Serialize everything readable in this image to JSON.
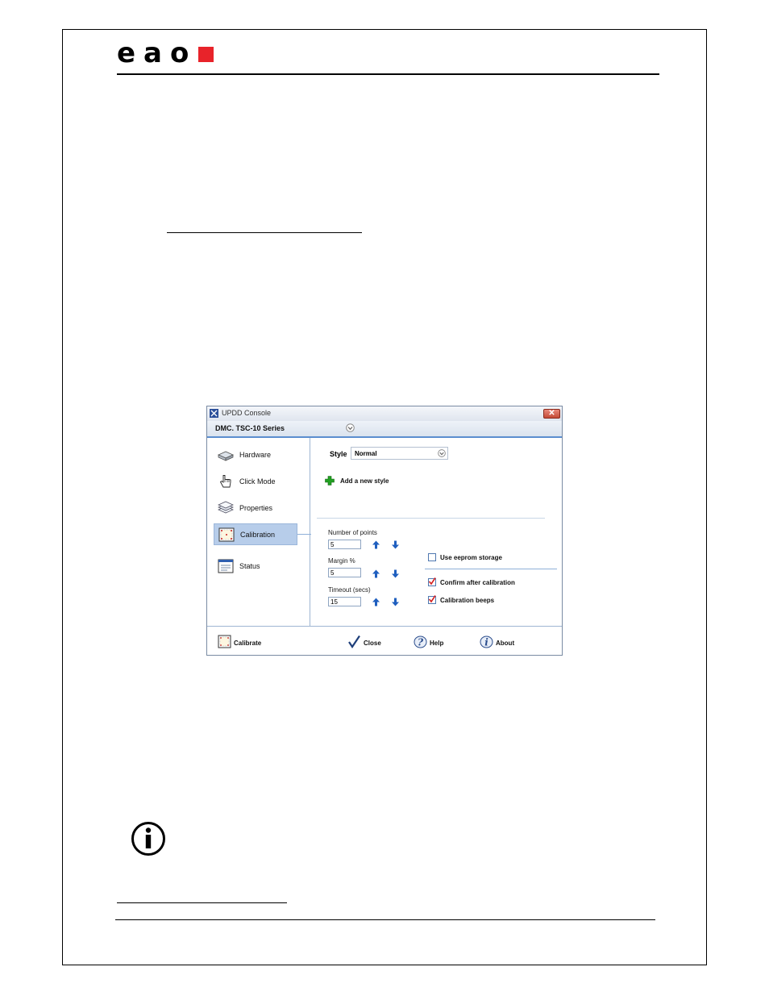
{
  "header": {
    "logo_text": "eao"
  },
  "dialog": {
    "title": "UPDD Console",
    "device_name": "DMC. TSC-10 Series",
    "close_glyph": "✕",
    "nav": [
      {
        "label": "Hardware",
        "icon": "hardware-icon"
      },
      {
        "label": "Click Mode",
        "icon": "hand-pointer-icon"
      },
      {
        "label": "Properties",
        "icon": "layers-icon"
      },
      {
        "label": "Calibration",
        "icon": "calibration-icon",
        "selected": true
      },
      {
        "label": "Status",
        "icon": "status-window-icon"
      }
    ],
    "style_label": "Style",
    "style_value": "Normal",
    "add_style_label": "Add a new style",
    "fields": {
      "points_label": "Number of points",
      "points_value": "5",
      "margin_label": "Margin %",
      "margin_value": "5",
      "timeout_label": "Timeout (secs)",
      "timeout_value": "15"
    },
    "checkboxes": {
      "eeprom_label": "Use eeprom storage",
      "eeprom_checked": false,
      "confirm_label": "Confirm after calibration",
      "confirm_checked": true,
      "beeps_label": "Calibration beeps",
      "beeps_checked": true
    },
    "buttons": {
      "calibrate": "Calibrate",
      "close": "Close",
      "help": "Help",
      "about": "About"
    },
    "colors": {
      "accent": "#5b8ecf",
      "selected": "#b7cdea",
      "arrow": "#1f5fbf",
      "check": "#d42020",
      "add": "#22a022"
    }
  },
  "colors": {
    "logo_square": "#e8232a"
  }
}
